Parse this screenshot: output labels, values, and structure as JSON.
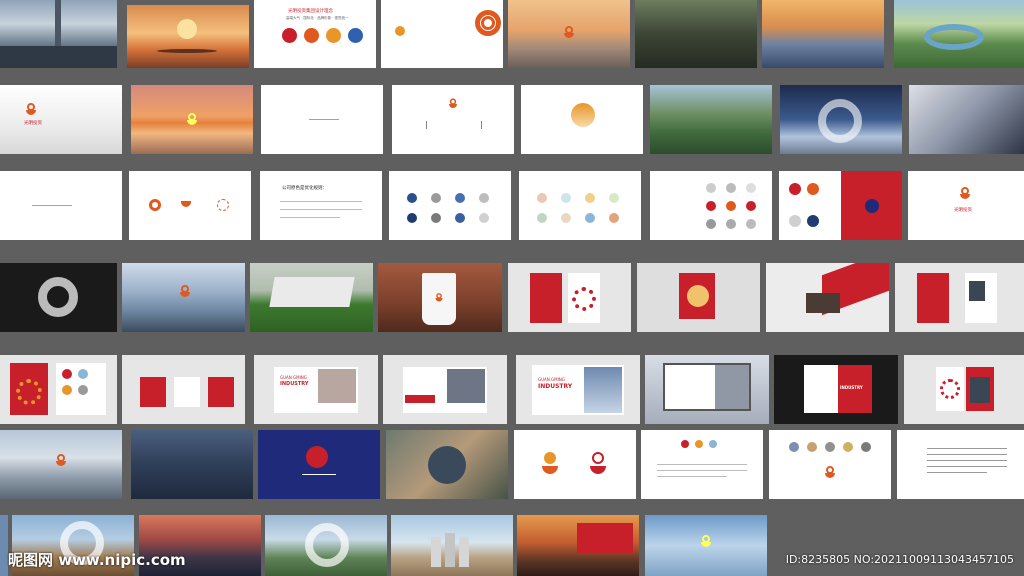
{
  "watermark": {
    "site": "昵图网 www.nipic.com",
    "id": "ID:8235805 NO:20211009113043457105"
  },
  "slide_texts": {
    "r1_t3_title": "光明投资集团设计理念",
    "r1_t3_sub": "高端大气 · 国际化 · 品牌形象 · 视觉统一",
    "r3_t3_title": "公司原色是优化规则：",
    "r5_t3_a": "GUAN GMING",
    "r5_t3_b": "INDUSTRY",
    "r5_t6_a": "GUAN GMING",
    "r5_t6_b": "INDUSTRY",
    "r5_t8_b": "INDUSTRY",
    "r2_t1_name": "光明投资",
    "r3_t8_name": "光明投资"
  },
  "colors": {
    "brand_orange": "#e05a1f",
    "brand_red": "#c8202a",
    "background": "#5f5f5f"
  }
}
